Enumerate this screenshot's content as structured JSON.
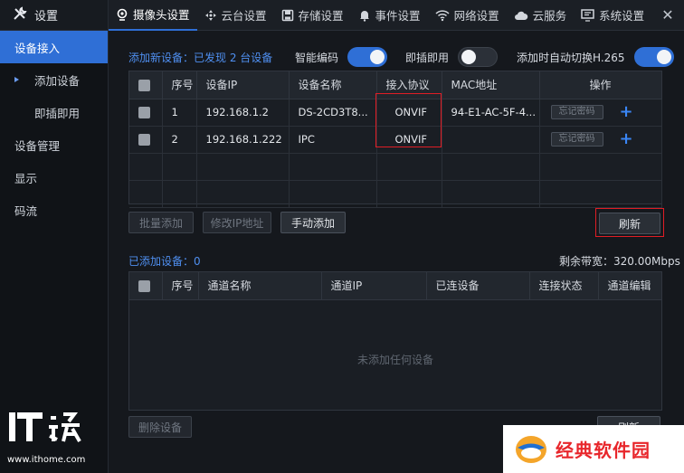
{
  "sidebar": {
    "title": "设置",
    "items": [
      {
        "label": "设备接入",
        "active": true
      },
      {
        "label": "添加设备",
        "sub": true,
        "bullet": true
      },
      {
        "label": "即插即用",
        "sub": true
      },
      {
        "label": "设备管理"
      },
      {
        "label": "显示"
      },
      {
        "label": "码流"
      }
    ]
  },
  "tabs": [
    {
      "label": "摄像头设置",
      "icon": "camera-icon",
      "active": true
    },
    {
      "label": "云台设置",
      "icon": "ptz-icon"
    },
    {
      "label": "存储设置",
      "icon": "storage-icon"
    },
    {
      "label": "事件设置",
      "icon": "bell-icon"
    },
    {
      "label": "网络设置",
      "icon": "wifi-icon"
    },
    {
      "label": "云服务",
      "icon": "cloud-icon"
    },
    {
      "label": "系统设置",
      "icon": "monitor-icon"
    }
  ],
  "close_glyph": "✕",
  "new_devices": {
    "label": "添加新设备：已发现 2 台设备",
    "smart_encode_label": "智能编码",
    "smart_encode_on": true,
    "plug_play_label": "即插即用",
    "plug_play_on": false,
    "auto_h265_label": "添加时自动切换H.265",
    "auto_h265_on": true,
    "columns": [
      "序号",
      "设备IP",
      "设备名称",
      "接入协议",
      "MAC地址",
      "操作"
    ],
    "rows": [
      {
        "index": "1",
        "ip": "192.168.1.2",
        "name": "DS-2CD3T8...",
        "protocol": "ONVIF",
        "mac": "94-E1-AC-5F-4...",
        "forget": "忘记密码"
      },
      {
        "index": "2",
        "ip": "192.168.1.222",
        "name": "IPC",
        "protocol": "ONVIF",
        "mac": "",
        "forget": "忘记密码"
      }
    ],
    "plus_glyph": "+",
    "buttons": {
      "batch_add": "批量添加",
      "modify_ip": "修改IP地址",
      "manual_add": "手动添加",
      "refresh": "刷新"
    }
  },
  "added_devices": {
    "label": "已添加设备：0",
    "bandwidth": "剩余带宽：320.00Mbps",
    "columns": [
      "序号",
      "通道名称",
      "通道IP",
      "已连设备",
      "连接状态",
      "通道编辑"
    ],
    "empty_text": "未添加任何设备",
    "buttons": {
      "delete": "删除设备",
      "refresh": "刷新"
    }
  },
  "watermarks": {
    "ithome_url": "www.ithome.com",
    "jd_text": "经典软件园"
  },
  "colors": {
    "accent": "#2f6fd6",
    "highlight": "#e01d25",
    "blue_text": "#4f8ff0"
  }
}
